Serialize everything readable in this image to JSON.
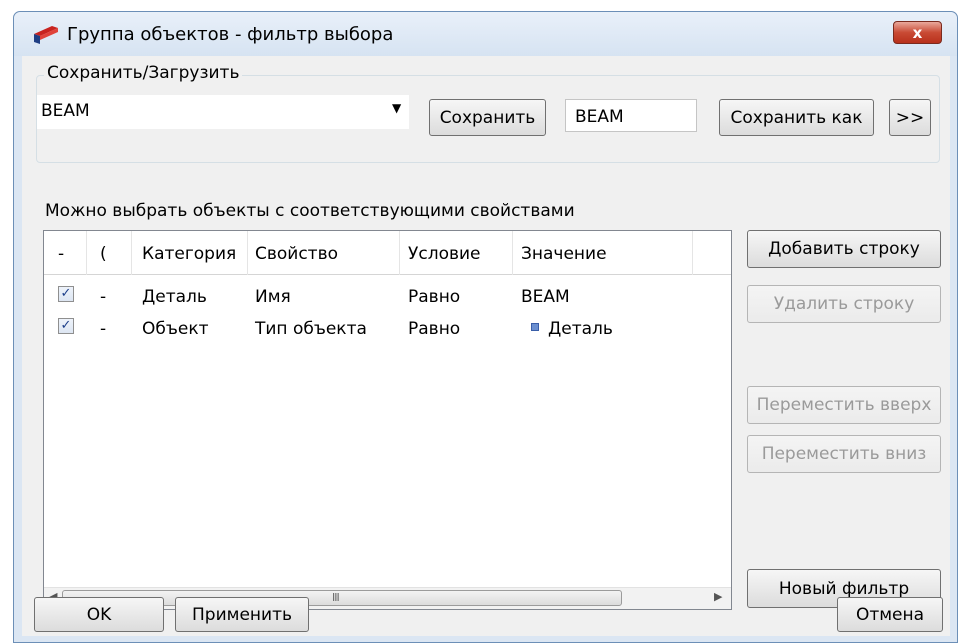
{
  "window": {
    "title": "Группа объектов - фильтр выбора",
    "close_label": "x"
  },
  "save_load": {
    "legend": "Сохранить/Загрузить",
    "selected_filter": "BEAM",
    "save_label": "Сохранить",
    "save_as_name": "BEAM",
    "save_as_label": "Сохранить как",
    "more_label": ">>"
  },
  "caption": "Можно выбрать объекты с соответствующими свойствами",
  "grid": {
    "headers": {
      "dash": "-",
      "paren": "(",
      "category": "Категория",
      "property": "Свойство",
      "condition": "Условие",
      "value": "Значение"
    },
    "rows": [
      {
        "checked": true,
        "paren": "-",
        "category": "Деталь",
        "property": "Имя",
        "condition": "Равно",
        "value": "BEAM",
        "value_icon": null
      },
      {
        "checked": true,
        "paren": "-",
        "category": "Объект",
        "property": "Тип объекта",
        "condition": "Равно",
        "value": "Деталь",
        "value_icon": "part-icon"
      }
    ],
    "scroll_grip": "III"
  },
  "side_buttons": {
    "add_row": "Добавить строку",
    "delete_row": "Удалить строку",
    "move_up": "Переместить вверх",
    "move_down": "Переместить вниз",
    "new_filter": "Новый фильтр"
  },
  "footer": {
    "ok": "OK",
    "apply": "Применить",
    "cancel": "Отмена"
  }
}
